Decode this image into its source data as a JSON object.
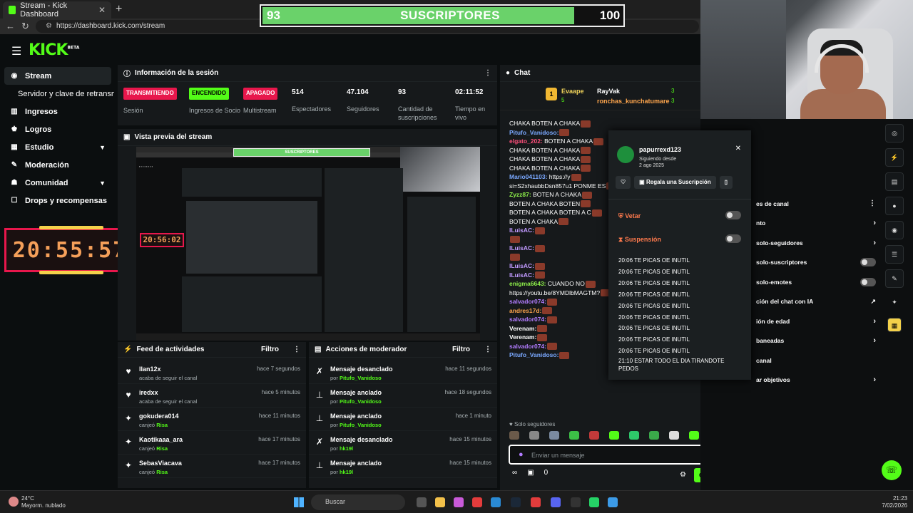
{
  "browser": {
    "tab_title": "Stream - Kick Dashboard",
    "url": "https://dashboard.kick.com/stream"
  },
  "overlay": {
    "current": "93",
    "label": "SUSCRIPTORES",
    "goal": "100",
    "progress": 0.93,
    "timer_main": "20:55:57",
    "timer_preview": "20:56:02"
  },
  "app": {
    "logo": "KICK",
    "logo_badge": "BETA"
  },
  "sidebar": {
    "items": [
      {
        "label": "Stream",
        "icon": "radio-icon"
      },
      {
        "label": "Servidor y clave de retransmisión",
        "icon": ""
      },
      {
        "label": "Ingresos",
        "icon": "chart-icon"
      },
      {
        "label": "Logros",
        "icon": "trophy-icon"
      },
      {
        "label": "Estudio",
        "icon": "layout-icon"
      },
      {
        "label": "Moderación",
        "icon": "wrench-icon"
      },
      {
        "label": "Comunidad",
        "icon": "people-icon"
      },
      {
        "label": "Drops y recompensas",
        "icon": "gift-icon"
      }
    ]
  },
  "session": {
    "title": "Información de la sesión",
    "stats": [
      {
        "badge": "TRANSMITIENDO",
        "badge_color": "#e8174c",
        "label": "Sesión"
      },
      {
        "badge": "ENCENDIDO",
        "badge_color": "#53fc18",
        "label": "Ingresos de Socio"
      },
      {
        "badge": "APAGADO",
        "badge_color": "#e8174c",
        "label": "Multistream"
      },
      {
        "value": "514",
        "label": "Espectadores"
      },
      {
        "value": "47.104",
        "label": "Seguidores"
      },
      {
        "value": "93",
        "label": "Cantidad de suscripciones"
      },
      {
        "value": "02:11:52",
        "label": "Tiempo en vivo"
      }
    ]
  },
  "preview": {
    "title": "Vista previa del stream"
  },
  "activity": {
    "title": "Feed de actividades",
    "filter": "Filtro",
    "items": [
      {
        "user": "llan12x",
        "sub": "acaba de seguir el canal",
        "reward": "",
        "time": "hace 7 segundos",
        "icon": "heart-icon"
      },
      {
        "user": "iredxx",
        "sub": "acaba de seguir el canal",
        "reward": "",
        "time": "hace 5 minutos",
        "icon": "heart-icon"
      },
      {
        "user": "gokudera014",
        "sub": "canjeó",
        "reward": "Risa",
        "time": "hace 11 minutos",
        "icon": "redeem-icon"
      },
      {
        "user": "Kaotikaaa_ara",
        "sub": "canjeó",
        "reward": "Risa",
        "time": "hace 17 minutos",
        "icon": "redeem-icon"
      },
      {
        "user": "SebasViacava",
        "sub": "canjeó",
        "reward": "Risa",
        "time": "hace 17 minutos",
        "icon": "redeem-icon"
      }
    ]
  },
  "mod": {
    "title": "Acciones de moderador",
    "filter": "Filtro",
    "items": [
      {
        "action": "Mensaje desanclado",
        "by": "por",
        "user": "Pitufo_Vanidoso",
        "time": "hace 11 segundos",
        "icon": "unpin-icon"
      },
      {
        "action": "Mensaje anclado",
        "by": "por",
        "user": "Pitufo_Vanidoso",
        "time": "hace 18 segundos",
        "icon": "pin-icon"
      },
      {
        "action": "Mensaje anclado",
        "by": "por",
        "user": "Pitufo_Vanidoso",
        "time": "hace 1 minuto",
        "icon": "pin-icon"
      },
      {
        "action": "Mensaje desanclado",
        "by": "por",
        "user": "hk19l",
        "time": "hace 15 minutos",
        "icon": "unpin-icon"
      },
      {
        "action": "Mensaje anclado",
        "by": "por",
        "user": "hk19l",
        "time": "hace 15 minutos",
        "icon": "pin-icon"
      }
    ]
  },
  "chat": {
    "title": "Chat",
    "leaders": {
      "rank": "1",
      "first": "Evaape",
      "first_count": "5",
      "second": "RayVak",
      "second_count": "3",
      "third": "ronchas_kunchatumare",
      "third_count": "3"
    },
    "lines": [
      {
        "user": "",
        "text": "CHAKA  BOTEN A CHAKA",
        "cls": ""
      },
      {
        "user": "Pitufo_Vanidoso:",
        "text": "",
        "cls": "u-blue"
      },
      {
        "user": "elgato_202:",
        "text": " BOTEN A CHAKA",
        "cls": "u-pink"
      },
      {
        "user": "",
        "text": "CHAKA  BOTEN A CHAKA",
        "cls": ""
      },
      {
        "user": "",
        "text": "CHAKA  BOTEN A CHAKA",
        "cls": ""
      },
      {
        "user": "",
        "text": "CHAKA  BOTEN A CHAKA",
        "cls": ""
      },
      {
        "user": "Mario041103:",
        "text": " https://y",
        "cls": "u-blue"
      },
      {
        "user": "",
        "text": "si=S2xhaubbDsn857u1 PONME ES",
        "cls": ""
      },
      {
        "user": "Zyzz87:",
        "text": " BOTEN A CHAKA",
        "cls": "u-green"
      },
      {
        "user": "",
        "text": "BOTEN A CHAKA  BOTEN",
        "cls": ""
      },
      {
        "user": "",
        "text": "BOTEN A CHAKA  BOTEN A C",
        "cls": ""
      },
      {
        "user": "",
        "text": "BOTEN A CHAKA",
        "cls": ""
      },
      {
        "user": "lLuisAC:",
        "text": "",
        "cls": "u-lilac"
      },
      {
        "user": "",
        "text": "",
        "cls": ""
      },
      {
        "user": "lLuisAC:",
        "text": "",
        "cls": "u-lilac"
      },
      {
        "user": "",
        "text": "",
        "cls": ""
      },
      {
        "user": "lLuisAC:",
        "text": "",
        "cls": "u-lilac"
      },
      {
        "user": "lLuisAC:",
        "text": "",
        "cls": "u-lilac"
      },
      {
        "user": "enigma6643:",
        "text": " CUANDO NO",
        "cls": "u-green"
      },
      {
        "user": "",
        "text": "https://youtu.be/8YMDlbMAGTM?",
        "cls": ""
      },
      {
        "user": "salvador074:",
        "text": "",
        "cls": "u-purple"
      },
      {
        "user": "andres17d:",
        "text": "",
        "cls": "u-orange"
      },
      {
        "user": "salvador074:",
        "text": "",
        "cls": "u-purple"
      },
      {
        "user": "Verenam:",
        "text": "",
        "cls": "u-white"
      },
      {
        "user": "Verenam:",
        "text": "",
        "cls": "u-white"
      },
      {
        "user": "salvador074:",
        "text": "",
        "cls": "u-purple"
      },
      {
        "user": "Pitufo_Vanidoso:",
        "text": "",
        "cls": "u-blue"
      }
    ],
    "followers_only": "Solo seguidores",
    "input_placeholder": "Enviar un mensaje",
    "points": "0",
    "send_label": "Chat"
  },
  "popup": {
    "username": "papurrexd123",
    "following_label": "Siguiendo desde",
    "following_date": "2 ago 2025",
    "gift_label": "Regala una Suscripción",
    "veto_label": "Vetar",
    "suspend_label": "Suspensión",
    "messages": [
      "20:06 TE PICAS OE INUTIL",
      "20:06 TE PICAS OE INUTIL",
      "20:06 TE PICAS OE INUTIL",
      "20:06 TE PICAS OE INUTIL",
      "20:06 TE PICAS OE INUTIL",
      "20:06 TE PICAS OE INUTIL",
      "20:06 TE PICAS OE INUTIL",
      "20:06 TE PICAS OE INUTIL",
      "20:06 TE PICAS OE INUTIL",
      "21:10 ESTAR TODO EL DIA TIRANDOTE PEDOS"
    ]
  },
  "channel_menu": {
    "title": "es de canal",
    "items": [
      {
        "label": "nto",
        "control": "chevron"
      },
      {
        "label": "solo-seguidores",
        "control": "chevron"
      },
      {
        "label": "solo-suscriptores",
        "control": "toggle"
      },
      {
        "label": "solo-emotes",
        "control": "toggle"
      },
      {
        "label": "ción del chat con IA",
        "control": "external"
      },
      {
        "label": "ión de edad",
        "control": "chevron"
      },
      {
        "label": "baneadas",
        "control": "chevron"
      },
      {
        "label": "canal",
        "control": ""
      },
      {
        "label": "ar objetivos",
        "control": "chevron"
      }
    ]
  },
  "taskbar": {
    "temp": "24°C",
    "weather": "Mayorm. nublado",
    "search": "Buscar",
    "time": "21:23",
    "date": "7/02/2026"
  }
}
